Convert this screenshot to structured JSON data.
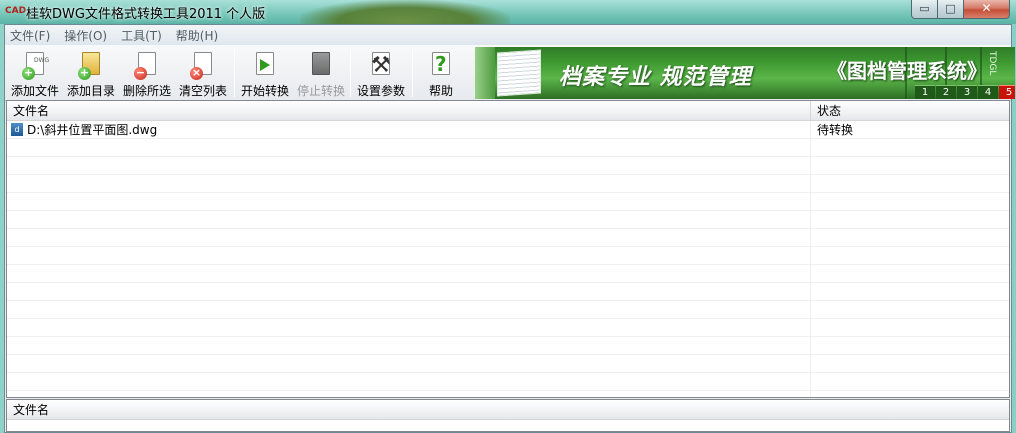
{
  "window": {
    "title": "桂软DWG文件格式转换工具2011 个人版",
    "app_icon_text": "CAD",
    "min_glyph": "▭",
    "max_glyph": "□",
    "close_glyph": "✕"
  },
  "menu": [
    {
      "label": "文件(F)"
    },
    {
      "label": "操作(O)"
    },
    {
      "label": "工具(T)"
    },
    {
      "label": "帮助(H)"
    }
  ],
  "toolbar": {
    "buttons": [
      {
        "label": "添加文件",
        "icon": "add-file-icon",
        "enabled": true
      },
      {
        "label": "添加目录",
        "icon": "add-folder-icon",
        "enabled": true
      },
      {
        "label": "删除所选",
        "icon": "delete-selected-icon",
        "enabled": true
      },
      {
        "label": "清空列表",
        "icon": "clear-list-icon",
        "enabled": true
      },
      {
        "label": "开始转换",
        "icon": "start-convert-icon",
        "enabled": true
      },
      {
        "label": "停止转换",
        "icon": "stop-convert-icon",
        "enabled": false
      },
      {
        "label": "设置参数",
        "icon": "settings-icon",
        "enabled": true
      },
      {
        "label": "帮助",
        "icon": "help-icon",
        "enabled": true
      }
    ],
    "dwg_label": "DWG"
  },
  "banner": {
    "slogan": "档案专业  规范管理",
    "product": "《图档管理系统》",
    "vertical_text": "TDGL",
    "steps": [
      "1",
      "2",
      "3",
      "4",
      "5"
    ]
  },
  "file_list": {
    "columns": [
      "文件名",
      "状态"
    ],
    "rows": [
      {
        "file": "D:\\斜井位置平面图.dwg",
        "status": "待转换"
      }
    ]
  },
  "bottom_panel": {
    "header": "文件名"
  },
  "colors": {
    "window_frame": "#6cc1b5",
    "close_button": "#c44e35",
    "banner_green": "#3e9a31",
    "disabled_text": "#9a9a9a"
  }
}
